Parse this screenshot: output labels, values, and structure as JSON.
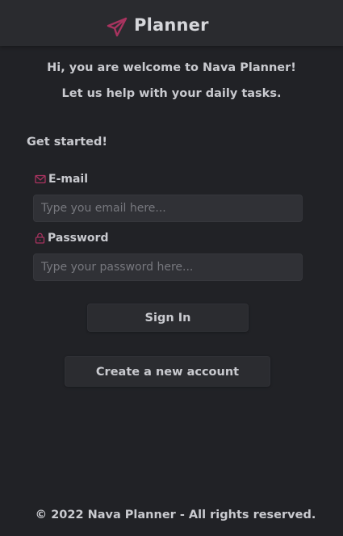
{
  "header": {
    "title": "Planner",
    "logo_icon": "paper-plane-icon",
    "accent_color": "#a8335f"
  },
  "welcome": {
    "line1": "Hi, you are welcome to Nava Planner!",
    "line2": "Let us help with your daily tasks."
  },
  "form": {
    "heading": "Get started!",
    "email": {
      "label": "E-mail",
      "icon": "envelope-icon",
      "value": "",
      "placeholder": "Type you email here..."
    },
    "password": {
      "label": "Password",
      "icon": "lock-icon",
      "value": "",
      "placeholder": "Type your password here..."
    },
    "signin_label": "Sign In",
    "create_account_label": "Create a new account"
  },
  "footer": {
    "copyright": "© 2022 Nava Planner - All rights reserved."
  }
}
